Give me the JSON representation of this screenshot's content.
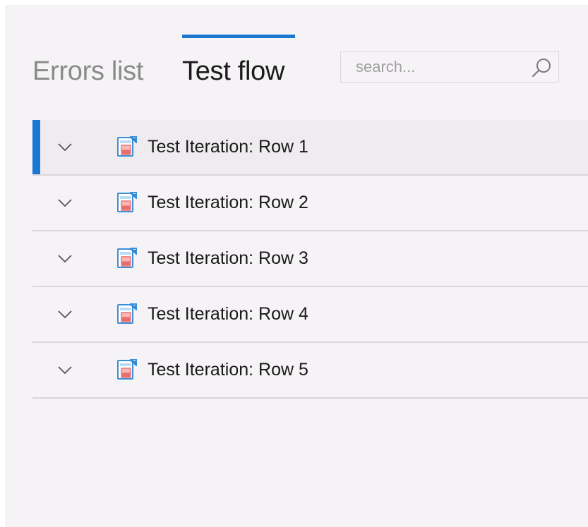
{
  "tabs": [
    {
      "label": "Errors list",
      "active": false
    },
    {
      "label": "Test flow",
      "active": true
    }
  ],
  "search": {
    "placeholder": "search...",
    "value": "",
    "icon": "search-icon"
  },
  "colors": {
    "accent": "#1a78d2",
    "panel_bg": "#f6f3f6",
    "selected_row_bg": "#efecef",
    "divider": "#d9d6d9"
  },
  "rows": [
    {
      "label": "Test Iteration: Row 1",
      "icon": "test-iteration-icon",
      "expander": "chevron-down-icon",
      "selected": true
    },
    {
      "label": "Test Iteration: Row 2",
      "icon": "test-iteration-icon",
      "expander": "chevron-down-icon",
      "selected": false
    },
    {
      "label": "Test Iteration: Row 3",
      "icon": "test-iteration-icon",
      "expander": "chevron-down-icon",
      "selected": false
    },
    {
      "label": "Test Iteration: Row 4",
      "icon": "test-iteration-icon",
      "expander": "chevron-down-icon",
      "selected": false
    },
    {
      "label": "Test Iteration: Row 5",
      "icon": "test-iteration-icon",
      "expander": "chevron-down-icon",
      "selected": false
    }
  ]
}
